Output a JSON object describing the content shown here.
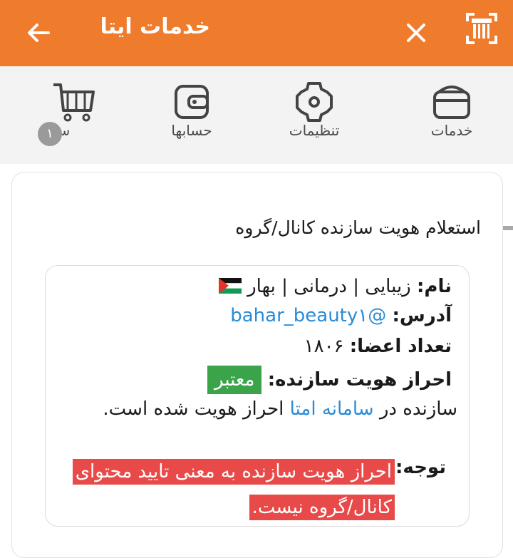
{
  "topbar": {
    "title": "خدمات ایتا",
    "back_icon": "arrow-left-icon",
    "close_icon": "close-icon",
    "scan_icon": "qr-scan-icon",
    "background": "#ef7b2d"
  },
  "tabs": [
    {
      "label": "خدمات",
      "icon": "services-box-icon"
    },
    {
      "label": "تنظیمات",
      "icon": "gear-icon"
    },
    {
      "label": "حسابها",
      "icon": "wallet-icon"
    },
    {
      "label": "سبد",
      "icon": "cart-icon",
      "badge": "۱"
    }
  ],
  "card": {
    "title": "استعلام هویت سازنده کانال/گروه",
    "name_label": "نام:",
    "name_value": "زیبایی | درمانی | بهار",
    "address_label": "آدرس:",
    "address_value": "@bahar_beauty۱",
    "members_label": "تعداد اعضا:",
    "members_value": "۱۸۰۶",
    "verify_label": "احراز هویت سازنده:",
    "verify_value": "معتبر",
    "verify_sentence_pre": "سازنده در",
    "verify_sentence_link": "سامانه امتا",
    "verify_sentence_post": "احراز هویت شده است.",
    "note_label": "توجه:",
    "note_line1": "احراز هویت سازنده به معنی تایید محتوای",
    "note_line2": "کانال/گروه نیست."
  }
}
